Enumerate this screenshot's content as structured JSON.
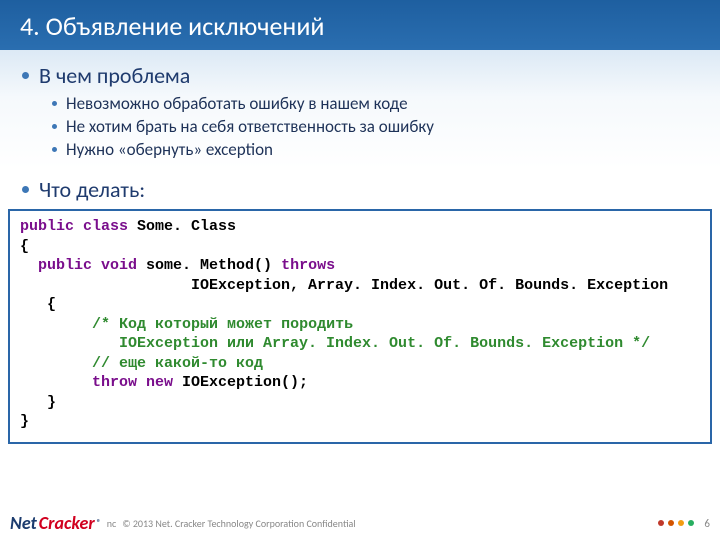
{
  "title": "4. Объявление исключений",
  "section1": {
    "heading": "В чем проблема",
    "points": [
      "Невозможно обработать ошибку в нашем коде",
      "Не хотим брать на себя ответственность за ошибку",
      "Нужно «обернуть» exception"
    ]
  },
  "section2": {
    "heading": "Что делать:"
  },
  "code": {
    "l1a": "public class",
    "l1b": " Some. Class",
    "l2": "{",
    "l3a": "  public void",
    "l3b": " some. Method() ",
    "l3c": "throws",
    "l4": "                   IOException, Array. Index. Out. Of. Bounds. Exception",
    "l5": "   {",
    "l6a": "        /* Код который ",
    "l6b": "может",
    "l6c": " породить",
    "l7": "           IOException или Array. Index. Out. Of. Bounds. Exception */",
    "l8": "        // еще какой-то код",
    "l9a": "        throw new",
    "l9b": " IOException();",
    "l10": "   }",
    "l11": "}"
  },
  "footer": {
    "logo_net": "Net",
    "logo_cracker": "Cracker",
    "reg": "®",
    "copyright_prefix": "nc",
    "copyright": "© 2013 Net. Cracker Technology Corporation Confidential",
    "page": "6"
  }
}
